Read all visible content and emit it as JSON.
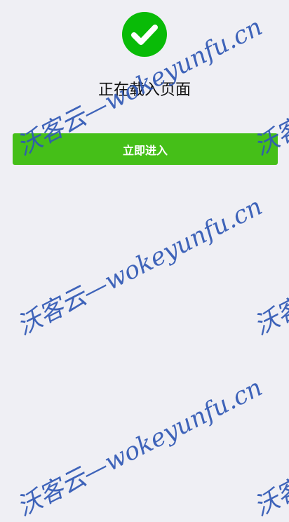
{
  "status": {
    "title": "正在载入页面",
    "icon": "checkmark-circle-icon",
    "icon_color": "#09bb07"
  },
  "actions": {
    "enter_label": "立即进入",
    "button_color": "#45bf18"
  },
  "watermark": {
    "text": "沃客云—wokeyunfu.cn",
    "color": "#2f58b5"
  }
}
